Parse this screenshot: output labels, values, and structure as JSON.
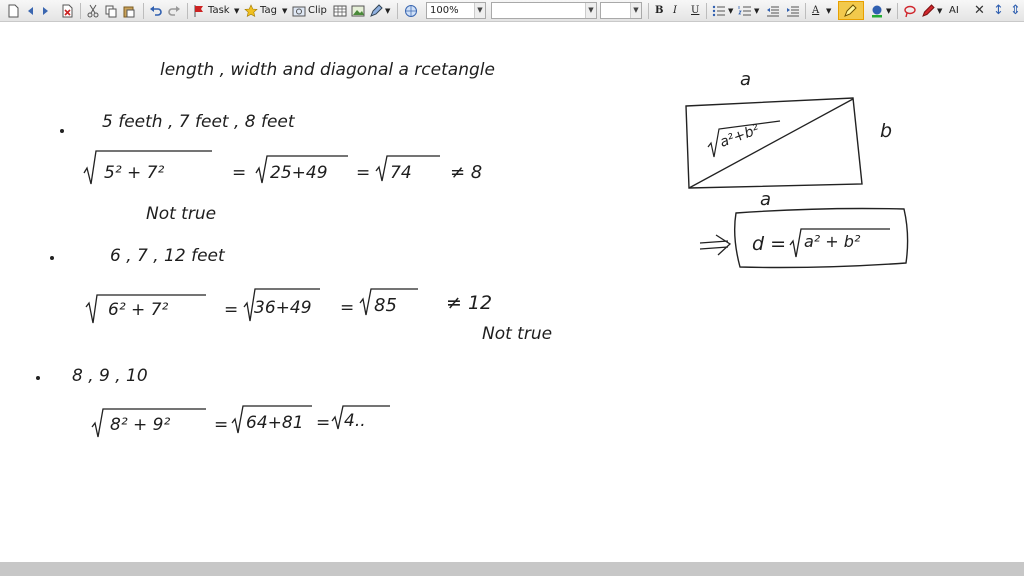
{
  "toolbar": {
    "task_label": "Task",
    "tag_label": "Tag",
    "clip_label": "Clip",
    "zoom_value": "100%",
    "bold_label": "B",
    "italic_label": "I",
    "underline_label": "U",
    "text_label": "A",
    "font_label": "AI",
    "colors": {
      "highlight": "#f2c94c",
      "highlight_accent": "#e8a000",
      "pen_red": "#d0262d",
      "flag_red": "#cc2222",
      "star_yellow": "#f0c020"
    }
  },
  "notes": {
    "title": "length , width and diagonal a rcetangle",
    "item1": {
      "line": "5 feeth , 7 feet , 8 feet",
      "sqrt_term": "5² + 7²",
      "sum": "25+49",
      "result": "74",
      "compare": "≠ 8",
      "verdict": "Not true"
    },
    "item2": {
      "line": "6 , 7 , 12 feet",
      "sqrt_term": "6² + 7²",
      "sum": "36+49",
      "result": "85",
      "compare": "≠ 12",
      "verdict": "Not true"
    },
    "item3": {
      "line": "8 , 9 , 10",
      "sqrt_term": "8² + 9²",
      "sum": "64+81",
      "result": "4.."
    },
    "diagram": {
      "top_label": "a",
      "bottom_label": "a",
      "side_label": "b",
      "diagonal_label": "a²+b²",
      "formula_d": "d =",
      "formula_term": "a² + b²"
    }
  }
}
